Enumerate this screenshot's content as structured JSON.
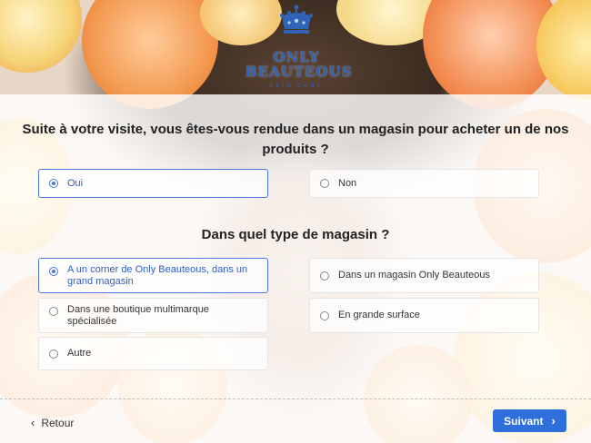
{
  "brand": {
    "name_line1": "ONLY",
    "name_line2": "BEAUTEOUS",
    "tagline": "SKIN CARE"
  },
  "question1": {
    "text": "Suite à votre visite, vous êtes-vous rendue dans un magasin pour acheter un de nos produits ?",
    "options": [
      {
        "label": "Oui",
        "selected": true
      },
      {
        "label": "Non",
        "selected": false
      }
    ]
  },
  "question2": {
    "text": "Dans quel type de magasin ?",
    "options": [
      {
        "label": "A un corner de Only Beauteous, dans un grand magasin",
        "selected": true
      },
      {
        "label": "Dans un magasin Only Beauteous",
        "selected": false
      },
      {
        "label": "Dans une boutique multimarque spécialisée",
        "selected": false
      },
      {
        "label": "En grande surface",
        "selected": false
      },
      {
        "label": "Autre",
        "selected": false
      }
    ]
  },
  "nav": {
    "back_label": "Retour",
    "next_label": "Suivant"
  },
  "colors": {
    "accent": "#2f6fdc",
    "brand": "#2f63b5",
    "selected_border": "#4a78d9"
  },
  "icons": {
    "back": "chevron-left-icon",
    "next": "chevron-right-icon",
    "logo": "crown-icon"
  }
}
